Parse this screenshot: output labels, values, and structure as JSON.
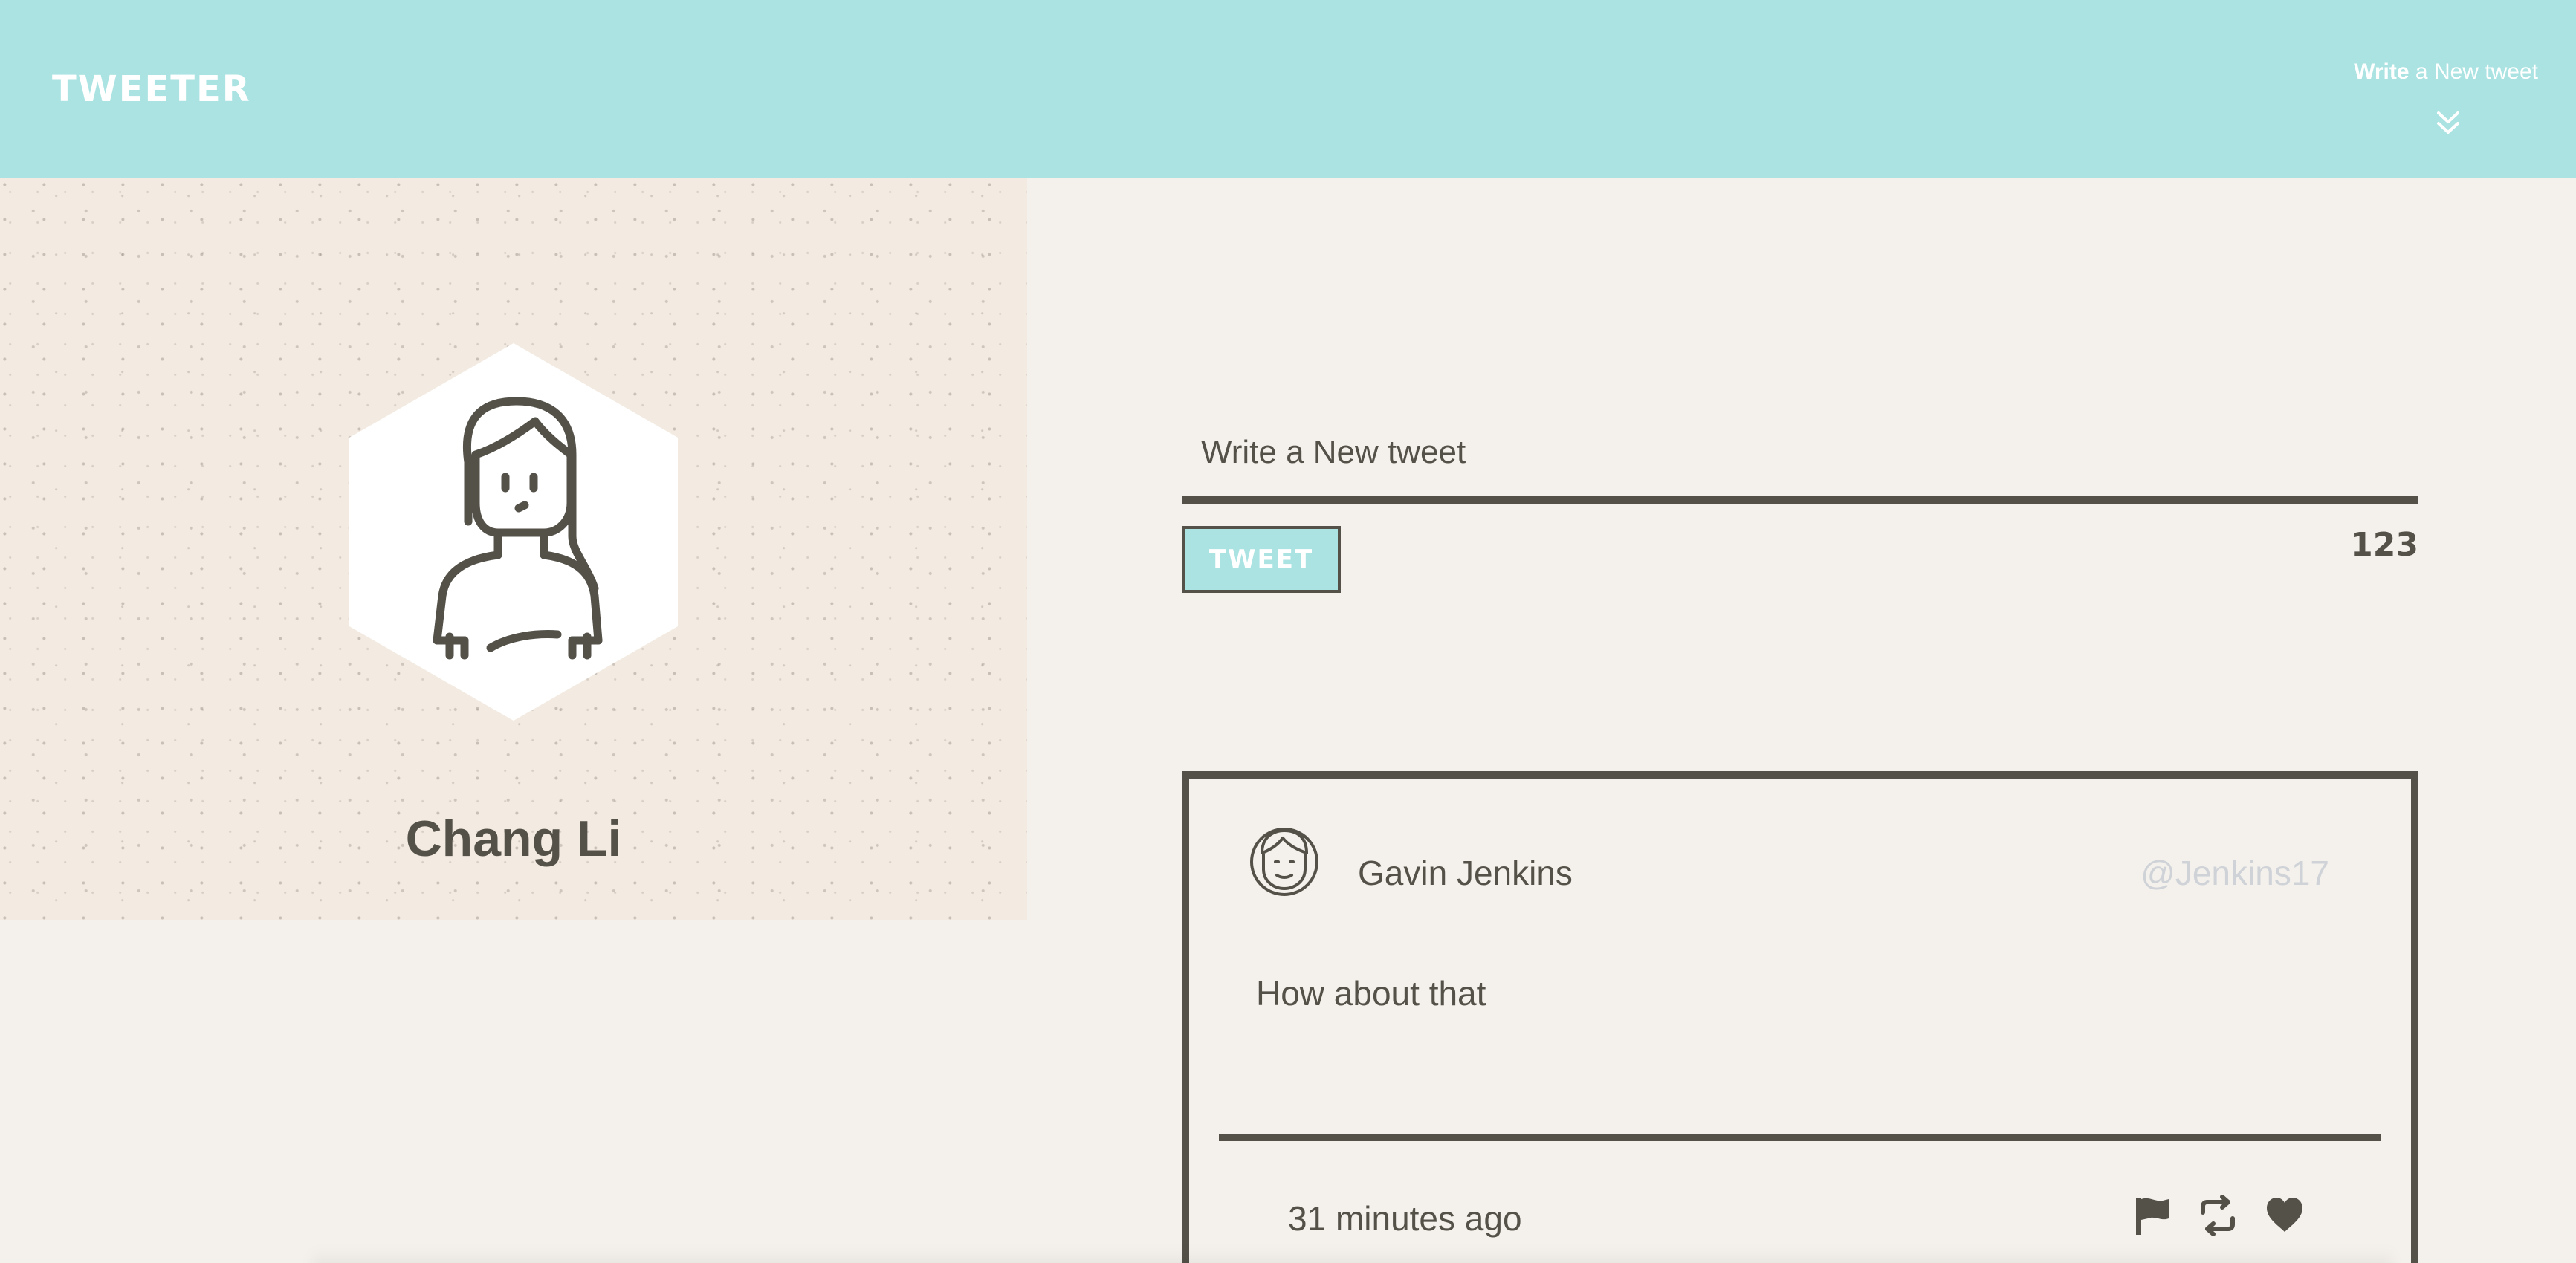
{
  "navbar": {
    "brand": "TWEETER",
    "compose_toggle": {
      "bold": "Write",
      "rest": "a New tweet",
      "icon": "double-chevron-down-icon"
    }
  },
  "profile": {
    "name": "Chang Li",
    "avatar_icon": "woman-avatar-icon"
  },
  "composer": {
    "placeholder": "Write a New tweet",
    "button_label": "TWEET",
    "char_counter": "123"
  },
  "tweets": [
    {
      "author": "Gavin Jenkins",
      "handle": "@Jenkins17",
      "avatar_icon": "man-avatar-icon",
      "text": "How about that",
      "time": "31 minutes ago",
      "actions": [
        "flag-icon",
        "retweet-icon",
        "heart-icon"
      ]
    }
  ],
  "colors": {
    "navbar_bg": "#aae3e2",
    "page_bg": "#f4f1ec",
    "profile_bg": "#f3ebe2",
    "ink": "#545149",
    "handle": "#cfd3d8"
  }
}
